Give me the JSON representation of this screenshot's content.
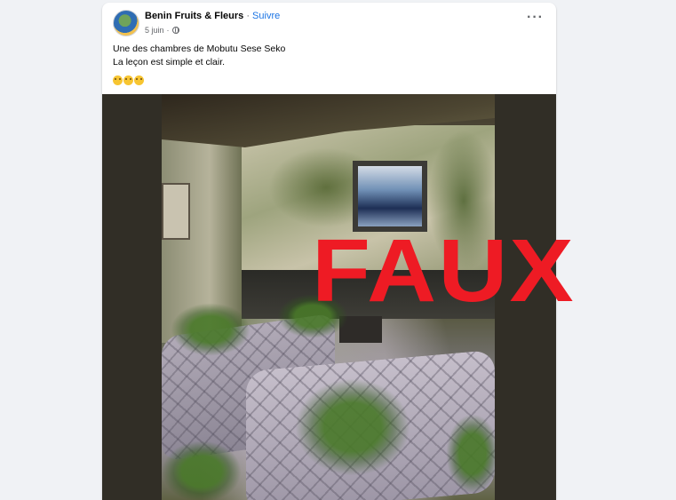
{
  "post": {
    "page_name": "Benin Fruits & Fleurs",
    "separator": "·",
    "follow_label": "Suivre",
    "date": "5 juin",
    "date_separator": "·",
    "more_label": "···",
    "text_line1": "Une des chambres de Mobutu Sese Seko",
    "text_line2": "La leçon est simple et clair.",
    "emoji_count": 3,
    "emoji_name": "face-with-spiral-eyes"
  },
  "image": {
    "description_icon": "photo",
    "overlay_label": "FAUX",
    "overlay_color": "#ee1b24"
  },
  "colors": {
    "background": "#f0f2f5",
    "card": "#ffffff",
    "link": "#1b74e4",
    "secondary_text": "#65676b",
    "media_background": "#312e26"
  }
}
